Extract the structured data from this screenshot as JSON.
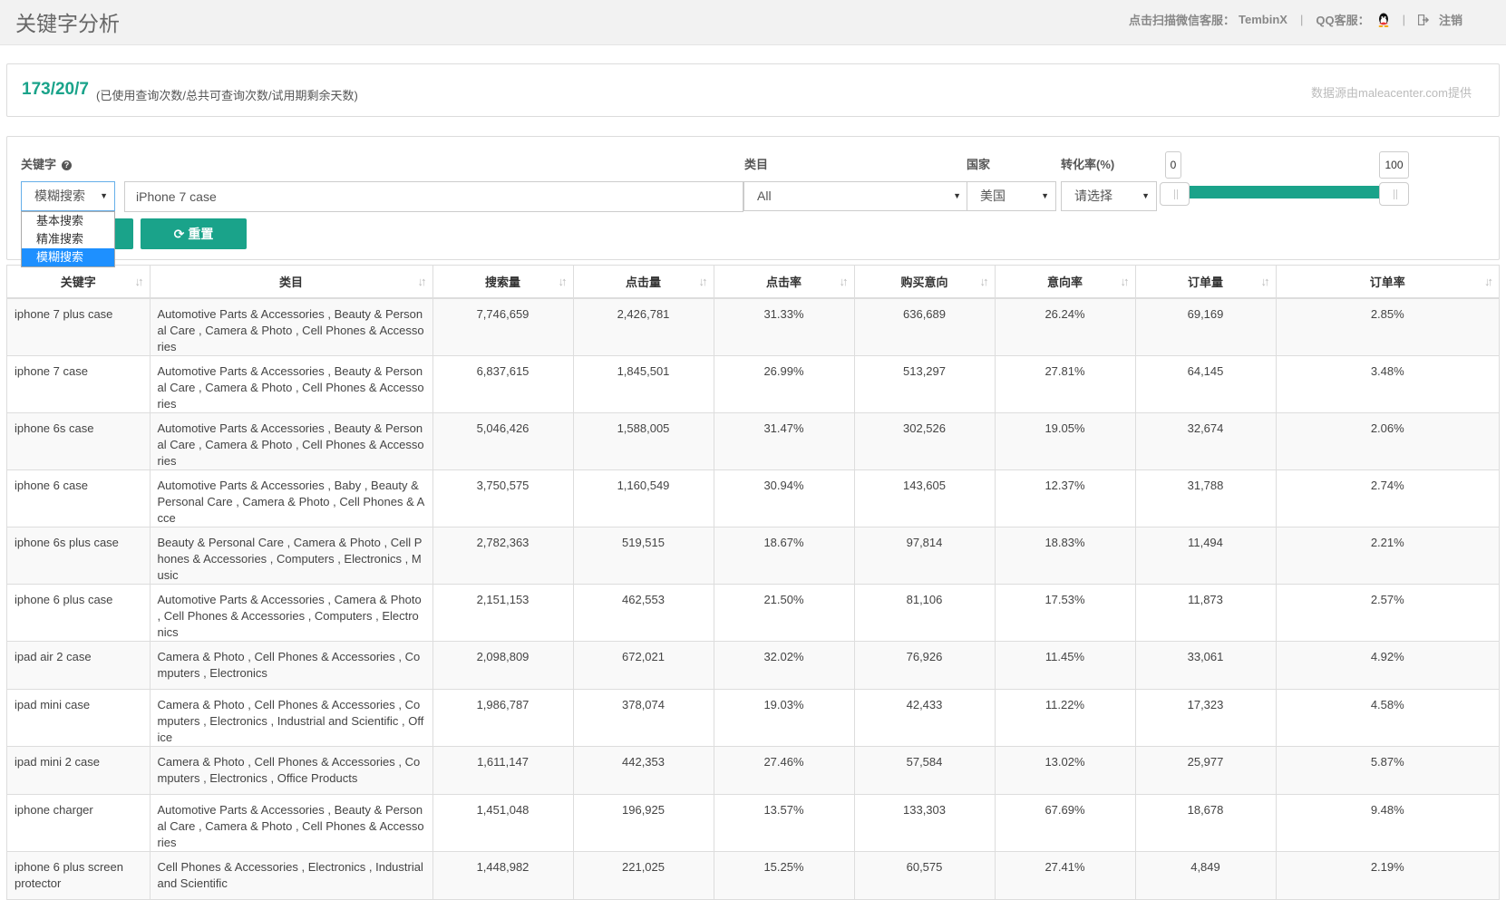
{
  "header": {
    "title": "关键字分析",
    "wechat_label": "点击扫描微信客服：",
    "wechat_name": "TembinX",
    "qq_label": "QQ客服：",
    "separator": "|",
    "logout": "注销"
  },
  "usage": {
    "count": "173/20/7",
    "description": "(已使用查询次数/总共可查询次数/试用期剩余天数)",
    "source": "数据源由maleacenter.com提供"
  },
  "filters": {
    "keyword_label": "关键字",
    "search_mode": "模糊搜索",
    "search_mode_options": [
      "基本搜索",
      "精准搜索",
      "模糊搜索"
    ],
    "keyword_value": "iPhone 7 case",
    "category_label": "类目",
    "category_value": "All",
    "country_label": "国家",
    "country_value": "美国",
    "conversion_label": "转化率(%)",
    "conversion_value": "请选择",
    "slider_min": "0",
    "slider_max": "100",
    "reset_label": "重置"
  },
  "table": {
    "columns": [
      "关键字",
      "类目",
      "搜索量",
      "点击量",
      "点击率",
      "购买意向",
      "意向率",
      "订单量",
      "订单率"
    ],
    "rows": [
      [
        "iphone 7 plus case",
        "Automotive Parts & Accessories , Beauty & Personal Care , Camera & Photo , Cell Phones & Accessories",
        "7,746,659",
        "2,426,781",
        "31.33%",
        "636,689",
        "26.24%",
        "69,169",
        "2.85%"
      ],
      [
        "iphone 7 case",
        "Automotive Parts & Accessories , Beauty & Personal Care , Camera & Photo , Cell Phones & Accessories",
        "6,837,615",
        "1,845,501",
        "26.99%",
        "513,297",
        "27.81%",
        "64,145",
        "3.48%"
      ],
      [
        "iphone 6s case",
        "Automotive Parts & Accessories , Beauty & Personal Care , Camera & Photo , Cell Phones & Accessories",
        "5,046,426",
        "1,588,005",
        "31.47%",
        "302,526",
        "19.05%",
        "32,674",
        "2.06%"
      ],
      [
        "iphone 6 case",
        "Automotive Parts & Accessories , Baby , Beauty & Personal Care , Camera & Photo , Cell Phones & Acce",
        "3,750,575",
        "1,160,549",
        "30.94%",
        "143,605",
        "12.37%",
        "31,788",
        "2.74%"
      ],
      [
        "iphone 6s plus case",
        "Beauty & Personal Care , Camera & Photo , Cell Phones & Accessories , Computers , Electronics , Music",
        "2,782,363",
        "519,515",
        "18.67%",
        "97,814",
        "18.83%",
        "11,494",
        "2.21%"
      ],
      [
        "iphone 6 plus case",
        "Automotive Parts & Accessories , Camera & Photo , Cell Phones & Accessories , Computers , Electronics",
        "2,151,153",
        "462,553",
        "21.50%",
        "81,106",
        "17.53%",
        "11,873",
        "2.57%"
      ],
      [
        "ipad air 2 case",
        "Camera & Photo , Cell Phones & Accessories , Computers , Electronics",
        "2,098,809",
        "672,021",
        "32.02%",
        "76,926",
        "11.45%",
        "33,061",
        "4.92%"
      ],
      [
        "ipad mini case",
        "Camera & Photo , Cell Phones & Accessories , Computers , Electronics , Industrial and Scientific , Office",
        "1,986,787",
        "378,074",
        "19.03%",
        "42,433",
        "11.22%",
        "17,323",
        "4.58%"
      ],
      [
        "ipad mini 2 case",
        "Camera & Photo , Cell Phones & Accessories , Computers , Electronics , Office Products",
        "1,611,147",
        "442,353",
        "27.46%",
        "57,584",
        "13.02%",
        "25,977",
        "5.87%"
      ],
      [
        "iphone charger",
        "Automotive Parts & Accessories , Beauty & Personal Care , Camera & Photo , Cell Phones & Accessories",
        "1,451,048",
        "196,925",
        "13.57%",
        "133,303",
        "67.69%",
        "18,678",
        "9.48%"
      ],
      [
        "iphone 6 plus screen protector",
        "Cell Phones & Accessories , Electronics , Industrial and Scientific",
        "1,448,982",
        "221,025",
        "15.25%",
        "60,575",
        "27.41%",
        "4,849",
        "2.19%"
      ]
    ]
  },
  "colors": {
    "accent": "#1aa38a",
    "dropdown_highlight": "#1e90ff"
  }
}
